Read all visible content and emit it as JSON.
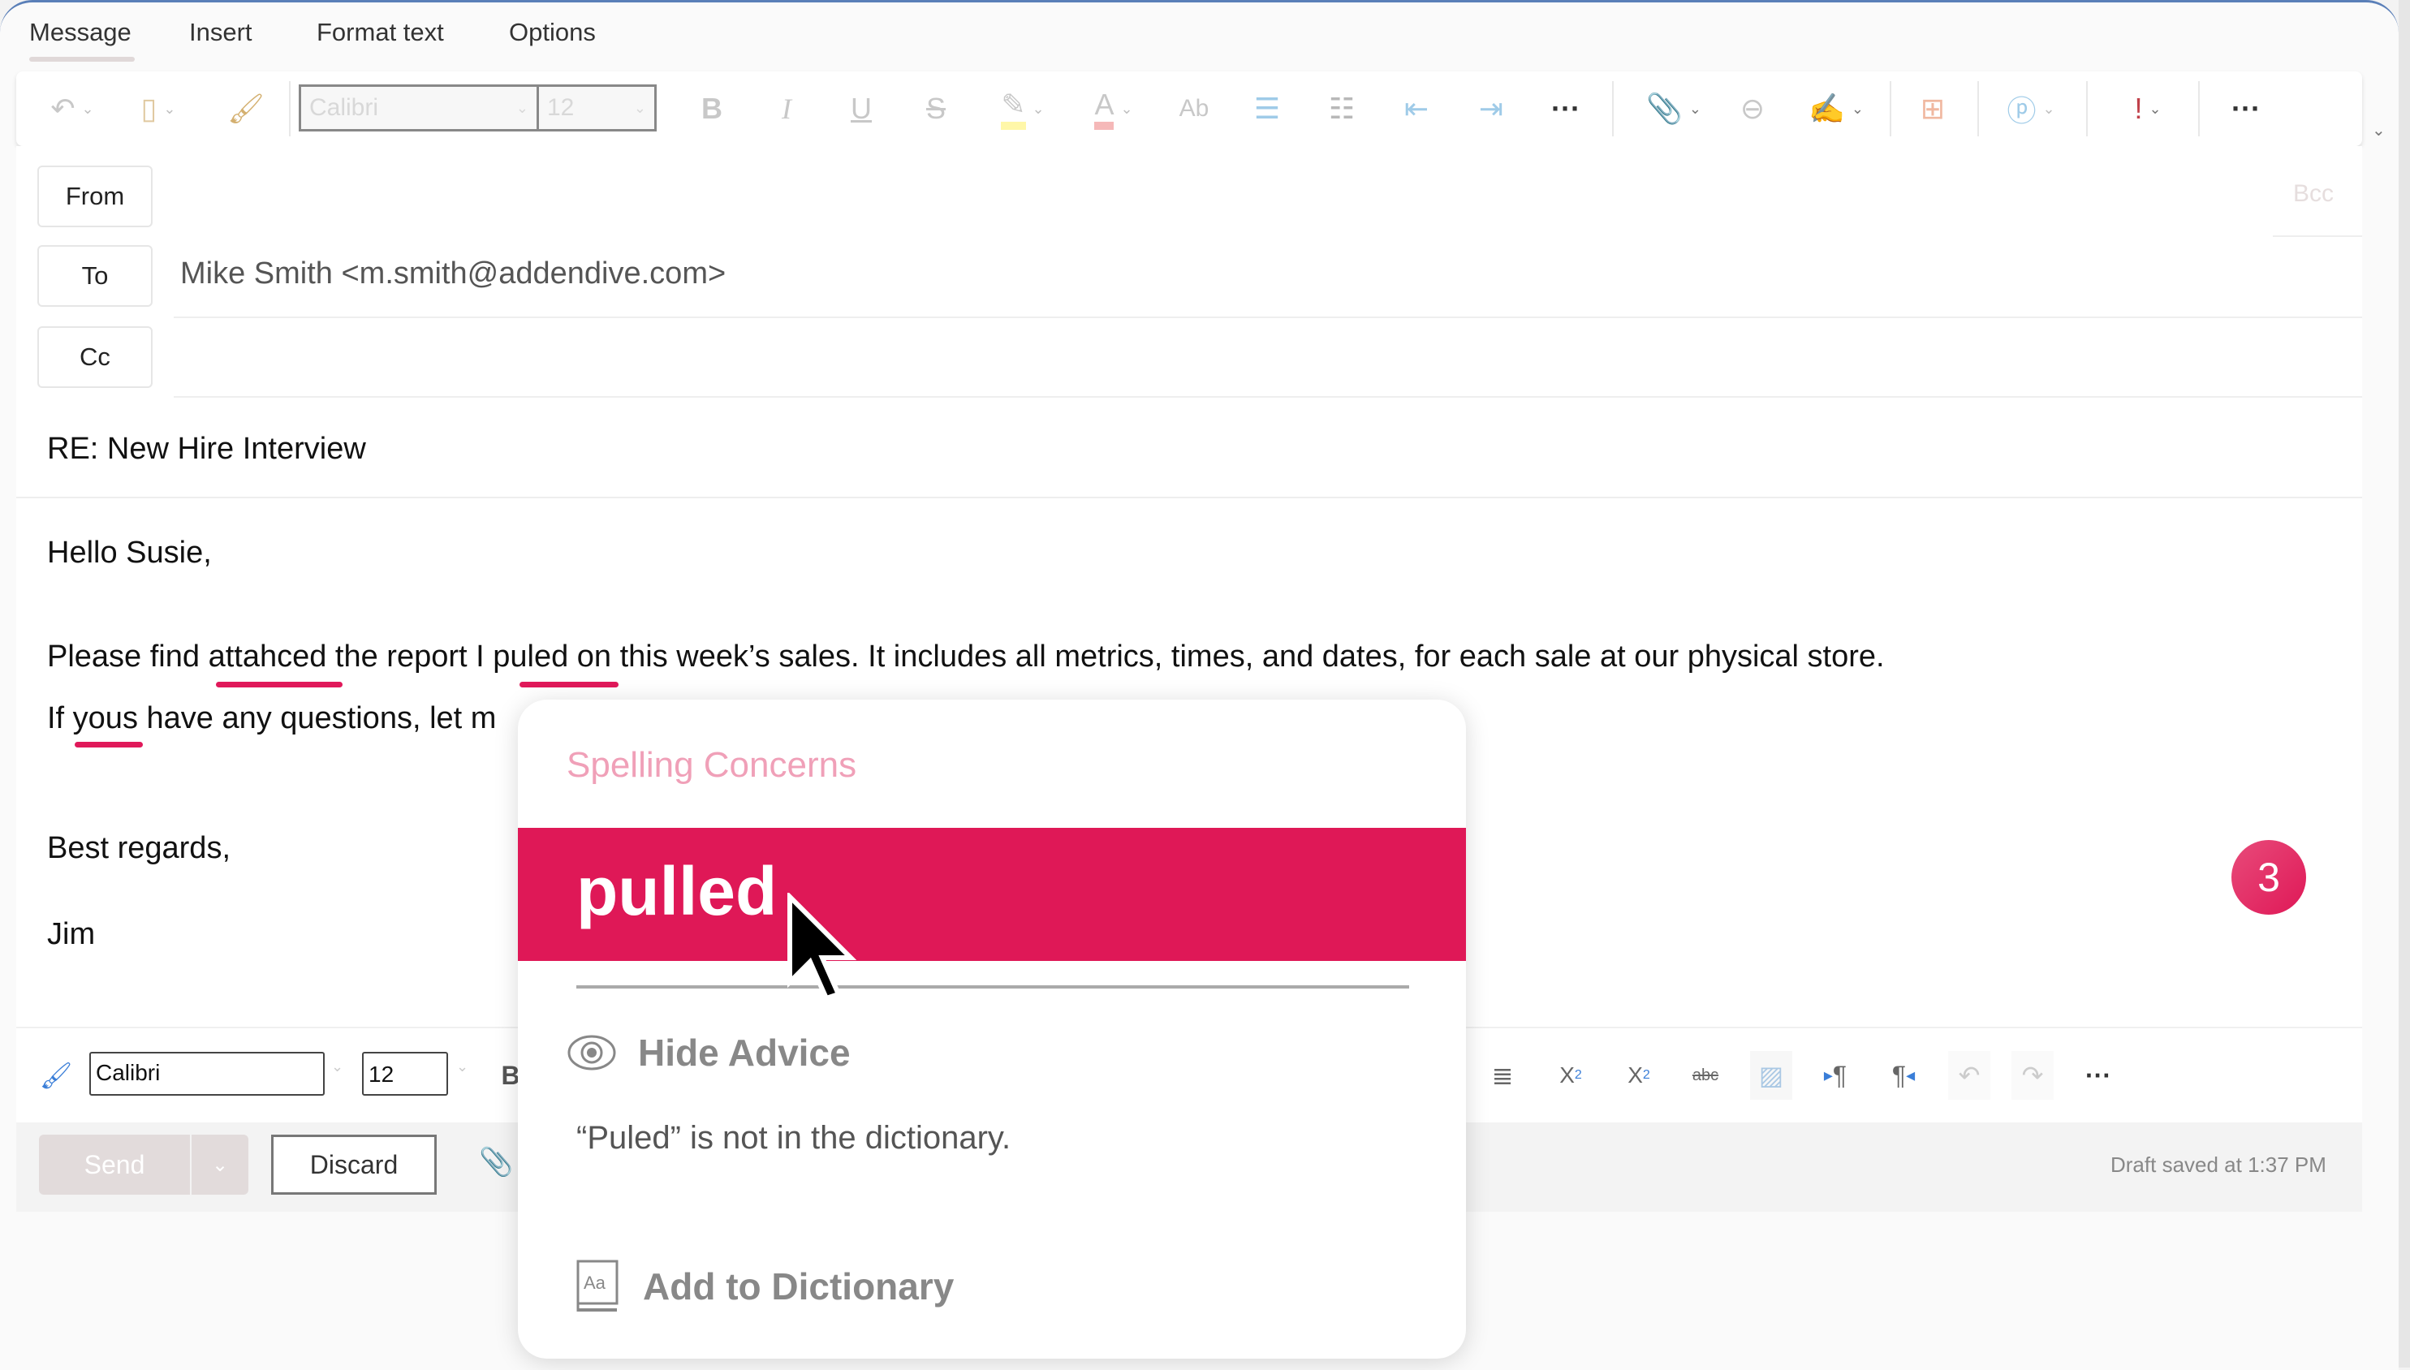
{
  "tabs": [
    {
      "label": "Message",
      "active": true
    },
    {
      "label": "Insert",
      "active": false
    },
    {
      "label": "Format text",
      "active": false
    },
    {
      "label": "Options",
      "active": false
    }
  ],
  "ribbon": {
    "font_name": "Calibri",
    "font_size": "12",
    "icons": [
      "undo-icon",
      "clipboard-icon",
      "format-painter-icon",
      "bold-icon",
      "italic-icon",
      "underline-icon",
      "strikethrough-icon",
      "highlight-icon",
      "font-color-icon",
      "spelling-icon",
      "bullets-icon",
      "numbering-icon",
      "decrease-indent-icon",
      "increase-indent-icon",
      "more-icon",
      "attach-icon",
      "link-icon",
      "signature-icon",
      "table-icon",
      "loop-icon",
      "importance-icon",
      "more-icon"
    ]
  },
  "fields": {
    "from_label": "From",
    "to_label": "To",
    "cc_label": "Cc",
    "bcc_label": "Bcc",
    "to_value": "Mike Smith <m.smith@addendive.com>",
    "cc_value": "",
    "subject": "RE: New Hire Interview"
  },
  "body": {
    "greeting": "Hello Susie,",
    "line1": "Please find attahced the report I puled on this week’s sales. It includes all metrics, times, and dates, for each sale at our physical store.",
    "line2": "If yous have any questions, let m",
    "closing": "Best regards,",
    "signature": "Jim",
    "misspelled": [
      "attahced",
      "puled",
      "yous"
    ]
  },
  "bottom_toolbar": {
    "font_name": "Calibri",
    "font_size": "12"
  },
  "actions": {
    "send": "Send",
    "discard": "Discard",
    "draft_status": "Draft saved at 1:37 PM"
  },
  "step_badge": "3",
  "popup": {
    "title": "Spelling Concerns",
    "suggestion": "pulled",
    "hide_advice": "Hide Advice",
    "message": "“Puled” is not in the dictionary.",
    "add_to_dictionary": "Add to Dictionary"
  },
  "colors": {
    "accent": "#df1857",
    "popup_title": "#f0a0b8",
    "window_border": "#5a7fb8"
  }
}
